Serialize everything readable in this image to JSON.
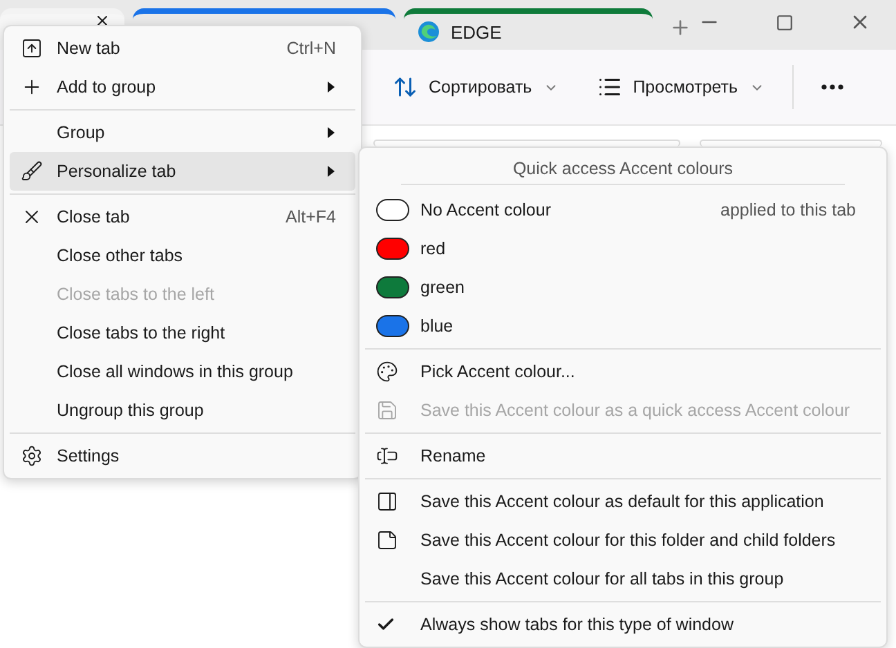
{
  "tabs": [
    {
      "color": "#f3f3f3",
      "selected": true
    },
    {
      "color": "#1a73e8",
      "selected": false
    },
    {
      "label": "EDGE",
      "color": "#0f7b3b",
      "selected": false
    }
  ],
  "toolbar": {
    "buttons": [
      {
        "label": "Сортировать"
      },
      {
        "label": "Просмотреть"
      }
    ]
  },
  "menu": {
    "items": [
      {
        "kind": "item",
        "label": "New tab",
        "shortcut": "Ctrl+N",
        "submenu": false,
        "disabled": false,
        "selected": false
      },
      {
        "kind": "item",
        "label": "Add to group",
        "submenu": true,
        "disabled": false,
        "selected": false
      },
      {
        "kind": "separator"
      },
      {
        "kind": "item",
        "label": "Group",
        "submenu": true,
        "disabled": false,
        "selected": false
      },
      {
        "kind": "item",
        "label": "Personalize tab",
        "submenu": true,
        "disabled": false,
        "selected": true
      },
      {
        "kind": "separator"
      },
      {
        "kind": "item",
        "label": "Close tab",
        "shortcut": "Alt+F4",
        "submenu": false,
        "disabled": false,
        "selected": false
      },
      {
        "kind": "item",
        "label": "Close other tabs",
        "submenu": false,
        "disabled": false,
        "selected": false
      },
      {
        "kind": "item",
        "label": "Close tabs to the left",
        "submenu": false,
        "disabled": true,
        "selected": false
      },
      {
        "kind": "item",
        "label": "Close tabs to the right",
        "submenu": false,
        "disabled": false,
        "selected": false
      },
      {
        "kind": "item",
        "label": "Close all windows in this group",
        "submenu": false,
        "disabled": false,
        "selected": false
      },
      {
        "kind": "item",
        "label": "Ungroup this group",
        "submenu": false,
        "disabled": false,
        "selected": false
      },
      {
        "kind": "separator"
      },
      {
        "kind": "item",
        "label": "Settings",
        "submenu": false,
        "disabled": false,
        "selected": false
      }
    ]
  },
  "submenu": {
    "header": "Quick access Accent colours",
    "items": [
      {
        "kind": "swatch",
        "label": "No Accent colour",
        "note": "applied to this tab",
        "color": "#ffffff"
      },
      {
        "kind": "swatch",
        "label": "red",
        "color": "#ff0000"
      },
      {
        "kind": "swatch",
        "label": "green",
        "color": "#0e7a3c"
      },
      {
        "kind": "swatch",
        "label": "blue",
        "color": "#1a73e8"
      },
      {
        "kind": "separator"
      },
      {
        "kind": "item",
        "label": "Pick Accent colour...",
        "disabled": false
      },
      {
        "kind": "item",
        "label": "Save this Accent colour as a quick access Accent colour",
        "disabled": true
      },
      {
        "kind": "separator"
      },
      {
        "kind": "item",
        "label": "Rename",
        "disabled": false
      },
      {
        "kind": "separator"
      },
      {
        "kind": "item",
        "label": "Save this Accent colour as default for this application",
        "disabled": false
      },
      {
        "kind": "item",
        "label": "Save this Accent colour for this folder and child folders",
        "disabled": false
      },
      {
        "kind": "item",
        "label": "Save this Accent colour for all tabs in this group",
        "disabled": false
      },
      {
        "kind": "separator"
      },
      {
        "kind": "check",
        "label": "Always show tabs for this type of window",
        "checked": true
      }
    ]
  }
}
